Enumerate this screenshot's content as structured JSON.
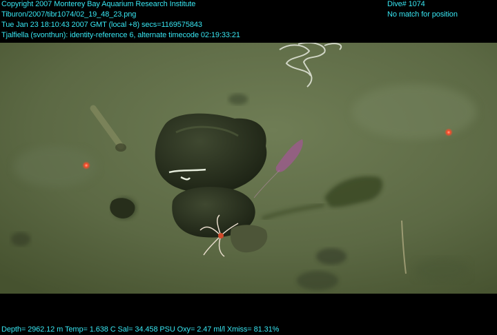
{
  "overlay": {
    "top_left": [
      "Copyright 2007 Monterey Bay Aquarium Research Institute",
      "Tiburon/2007/tibr1074/02_19_48_23.png",
      "Tue Jan 23 18:10:43 2007 GMT (local +8)  secs=1169575843",
      "Tjalfiella (svonthun): identity-reference 6, alternate timecode 02:19:33:21"
    ],
    "top_right": [
      "Dive# 1074",
      "No match for position"
    ],
    "bottom": "Depth= 2962.12 m  Temp= 1.638 C  Sal= 34.458 PSU  Oxy= 2.47 ml/l  Xmiss= 81.31%"
  },
  "colors": {
    "overlay_text": "#38e6f2",
    "background": "#000000",
    "seafloor": "#5f6d47",
    "laser": "#ff4a2a"
  }
}
